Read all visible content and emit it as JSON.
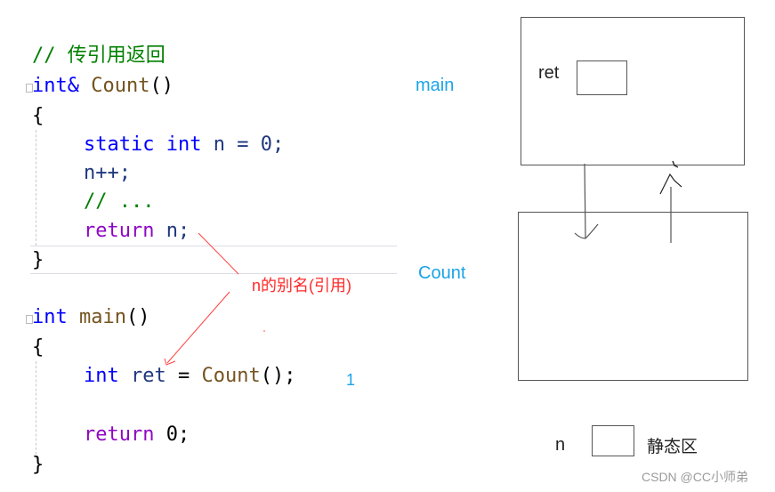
{
  "code": {
    "comment_title": "// 传引用返回",
    "count_func": {
      "return_type": "int&",
      "name": "Count",
      "parens": "()",
      "open_brace": "{",
      "line_static": {
        "kw1": "static",
        "kw2": "int",
        "rest": " n = 0;"
      },
      "line_inc": "n++;",
      "line_comment": "// ...",
      "line_return": {
        "kw": "return",
        "rest": " n;"
      },
      "close_brace": "}"
    },
    "main_func": {
      "return_type": "int",
      "name": "main",
      "parens": "()",
      "open_brace": "{",
      "line_decl": {
        "kw": "int",
        "var": "ret",
        "eq": " = ",
        "call": "Count",
        "tail": "();"
      },
      "line_return": {
        "kw": "return",
        "rest": " 0;"
      },
      "close_brace": "}"
    }
  },
  "annotations": {
    "frame_main": "main",
    "frame_count": "Count",
    "alias_note": "n的别名(引用)",
    "ret_value": "1"
  },
  "diagram": {
    "main_box_var": "ret",
    "static_var": "n",
    "static_area_label": "静态区"
  },
  "watermark": "CSDN @CC小师弟",
  "colors": {
    "keyword": "#0000ff",
    "control": "#8f08c4",
    "function": "#74531f",
    "comment": "#008000",
    "annotation_blue": "#1aa3e8",
    "annotation_red": "#ff2a2a"
  }
}
